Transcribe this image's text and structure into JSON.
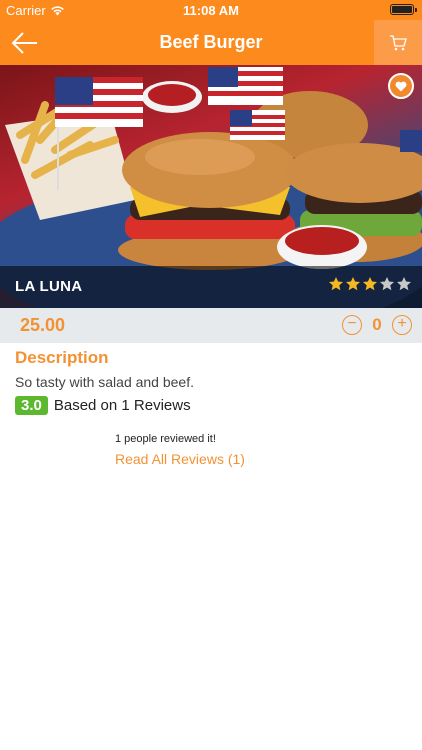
{
  "status_bar": {
    "carrier": "Carrier",
    "time": "11:08 AM"
  },
  "nav": {
    "title": "Beef Burger",
    "back_icon": "back-arrow-icon",
    "cart_icon": "cart-icon"
  },
  "hero": {
    "restaurant_name": "LA LUNA",
    "rating_stars": 3,
    "max_stars": 5,
    "favorite_icon": "heart-icon"
  },
  "price_bar": {
    "price": "25.00",
    "quantity": "0",
    "minus": "−",
    "plus": "+"
  },
  "description": {
    "title": "Description",
    "text": "So tasty with salad and beef."
  },
  "rating": {
    "score": "3.0",
    "summary": "Based on 1 Reviews"
  },
  "reviews": {
    "count_text": "1 people reviewed it!",
    "read_all": "Read All Reviews (1)"
  },
  "colors": {
    "accent": "#fd8a1c",
    "price": "#f39233",
    "badge": "#5cb82e"
  }
}
